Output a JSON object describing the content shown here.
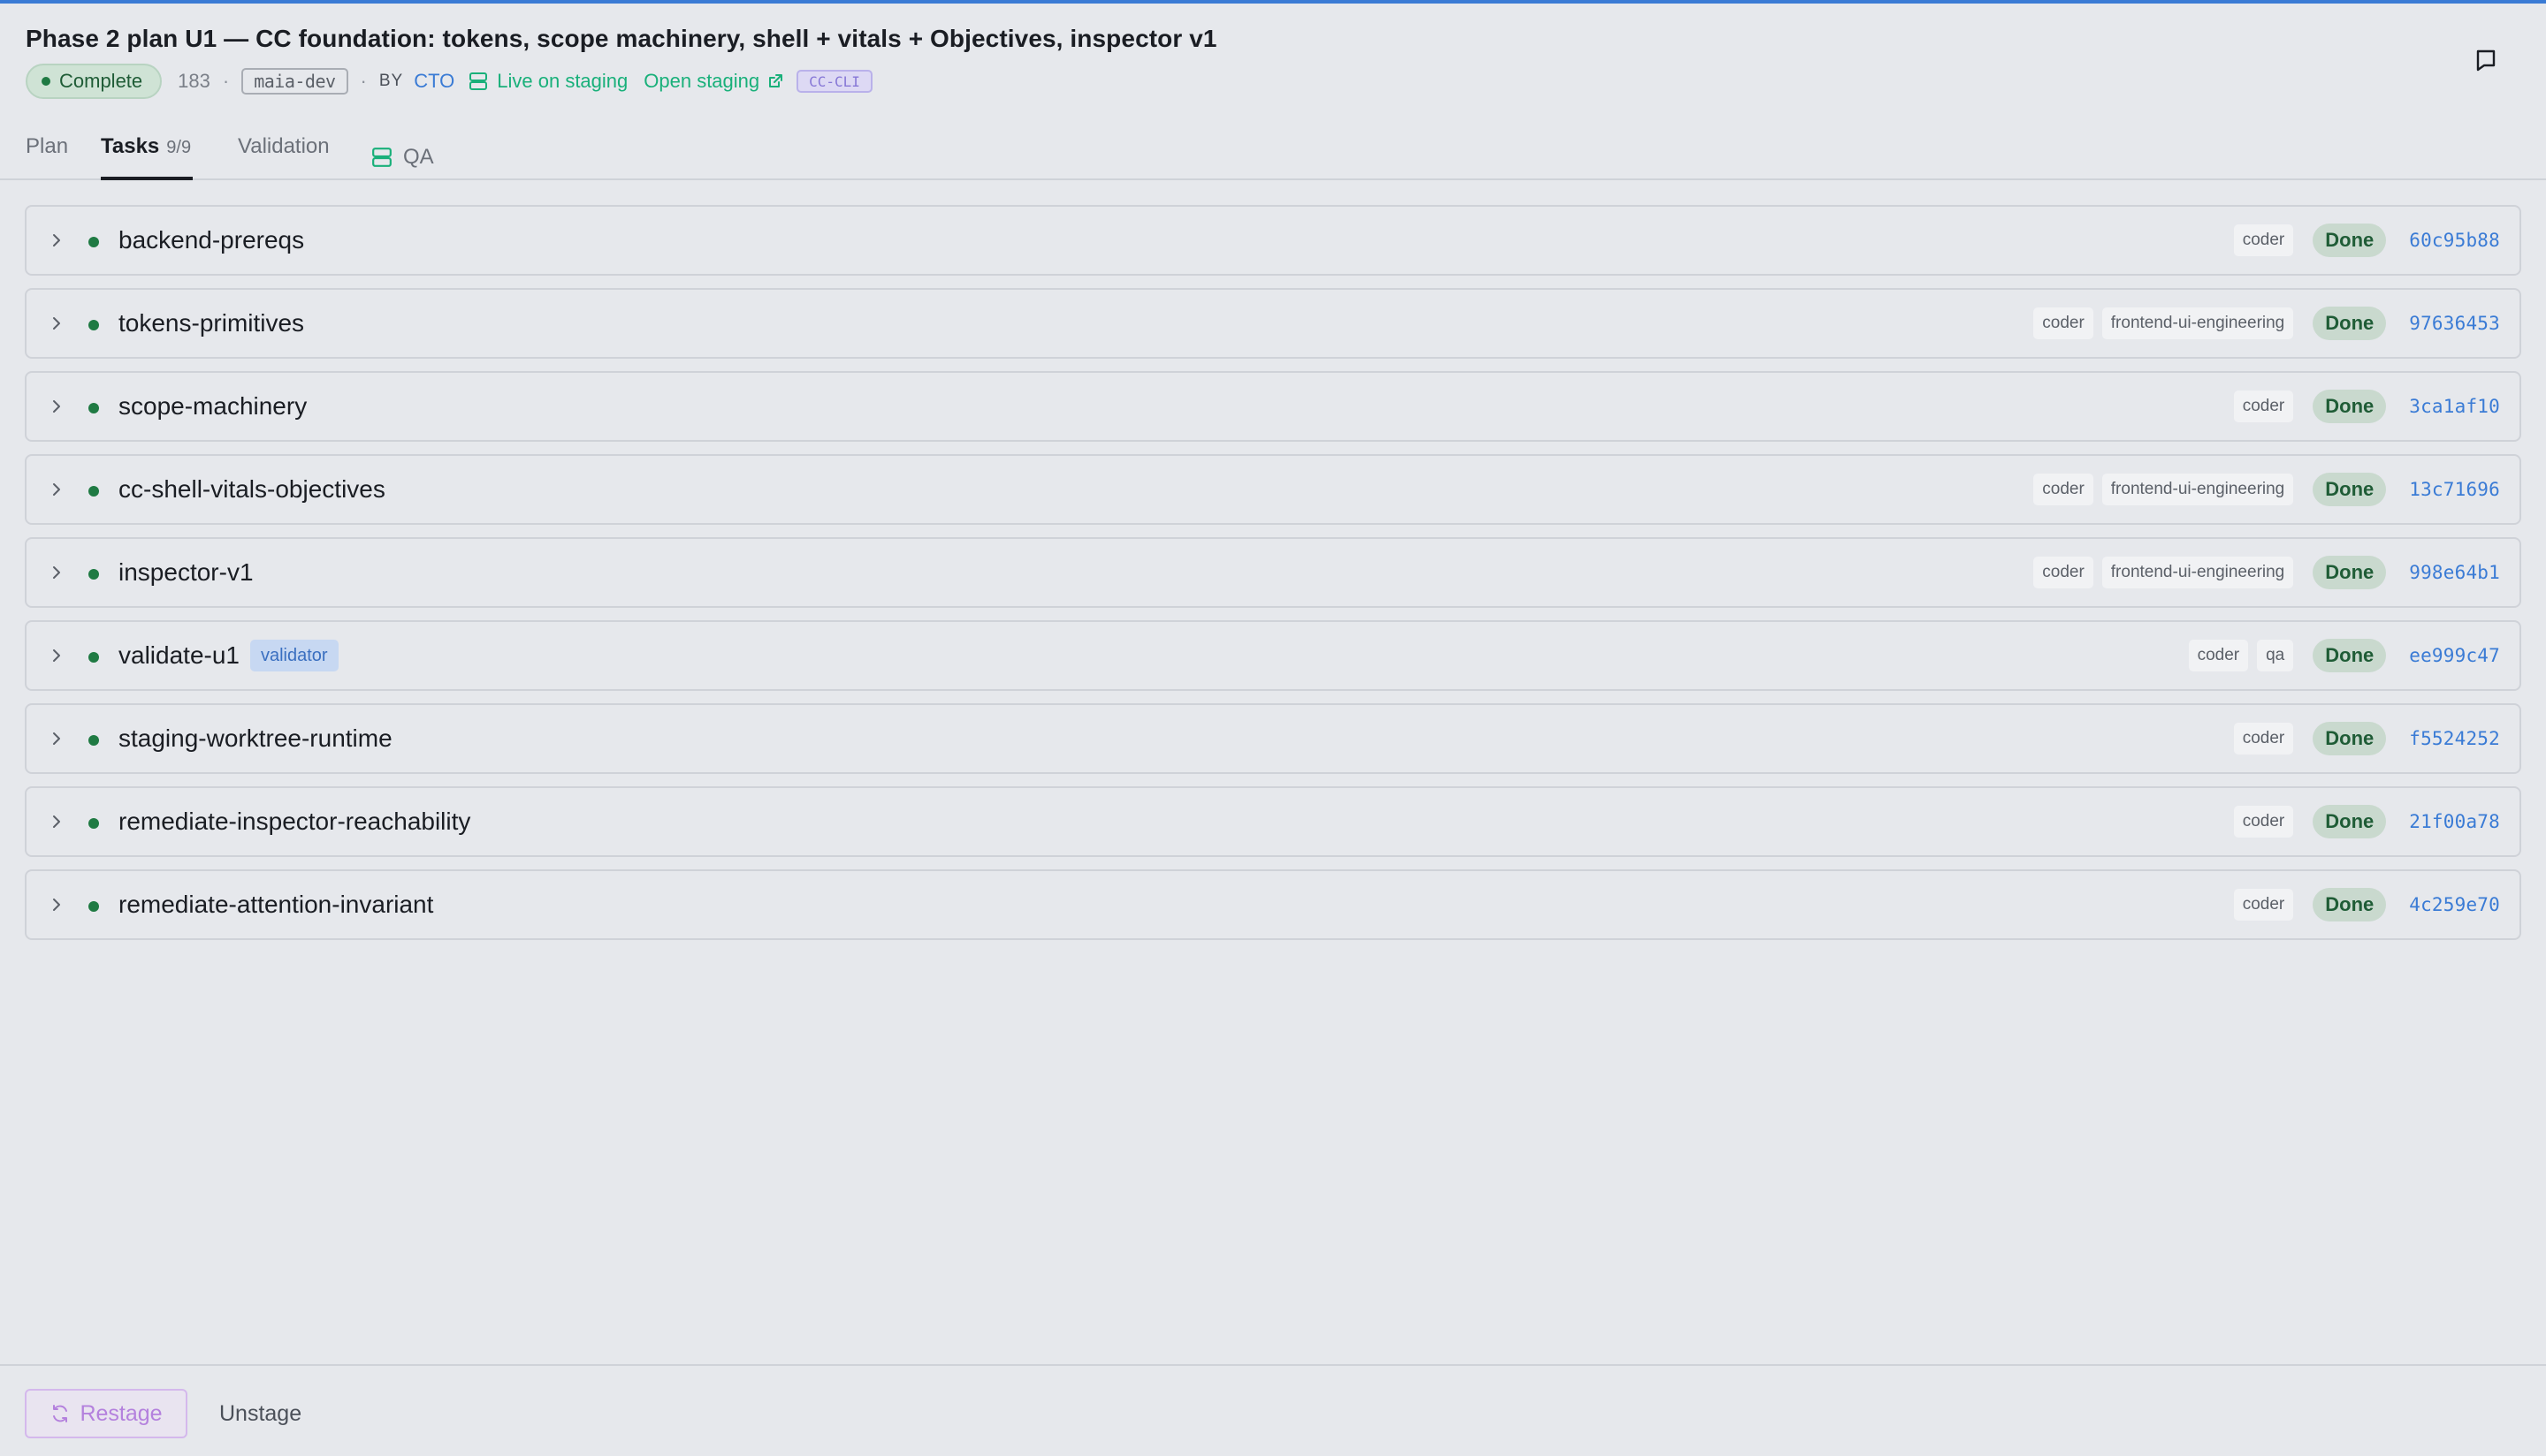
{
  "header": {
    "title": "Phase 2 plan U1 — CC foundation: tokens, scope machinery, shell + vitals + Objectives, inspector v1",
    "status": "Complete",
    "number": "183",
    "env": "maia-dev",
    "by_label": "BY",
    "author": "CTO",
    "live_label": "Live on staging",
    "open_label": "Open staging",
    "cli_label": "CC-CLI"
  },
  "tabs": [
    {
      "label": "Plan"
    },
    {
      "label": "Tasks",
      "count": "9/9"
    },
    {
      "label": "Validation"
    },
    {
      "label": "QA"
    }
  ],
  "tasks": [
    {
      "name": "backend-prereqs",
      "tags": [
        "coder"
      ],
      "status": "Done",
      "hash": "60c95b88"
    },
    {
      "name": "tokens-primitives",
      "tags": [
        "coder",
        "frontend-ui-engineering"
      ],
      "status": "Done",
      "hash": "97636453"
    },
    {
      "name": "scope-machinery",
      "tags": [
        "coder"
      ],
      "status": "Done",
      "hash": "3ca1af10"
    },
    {
      "name": "cc-shell-vitals-objectives",
      "tags": [
        "coder",
        "frontend-ui-engineering"
      ],
      "status": "Done",
      "hash": "13c71696"
    },
    {
      "name": "inspector-v1",
      "tags": [
        "coder",
        "frontend-ui-engineering"
      ],
      "status": "Done",
      "hash": "998e64b1"
    },
    {
      "name": "validate-u1",
      "badge": "validator",
      "tags": [
        "coder",
        "qa"
      ],
      "status": "Done",
      "hash": "ee999c47"
    },
    {
      "name": "staging-worktree-runtime",
      "tags": [
        "coder"
      ],
      "status": "Done",
      "hash": "f5524252"
    },
    {
      "name": "remediate-inspector-reachability",
      "tags": [
        "coder"
      ],
      "status": "Done",
      "hash": "21f00a78"
    },
    {
      "name": "remediate-attention-invariant",
      "tags": [
        "coder"
      ],
      "status": "Done",
      "hash": "4c259e70"
    }
  ],
  "footer": {
    "restage_label": "Restage",
    "unstage_label": "Unstage"
  },
  "colors": {
    "accent": "#3a7bd5",
    "success": "#1f7a43",
    "live": "#19b07a",
    "restage": "#b481dd"
  }
}
